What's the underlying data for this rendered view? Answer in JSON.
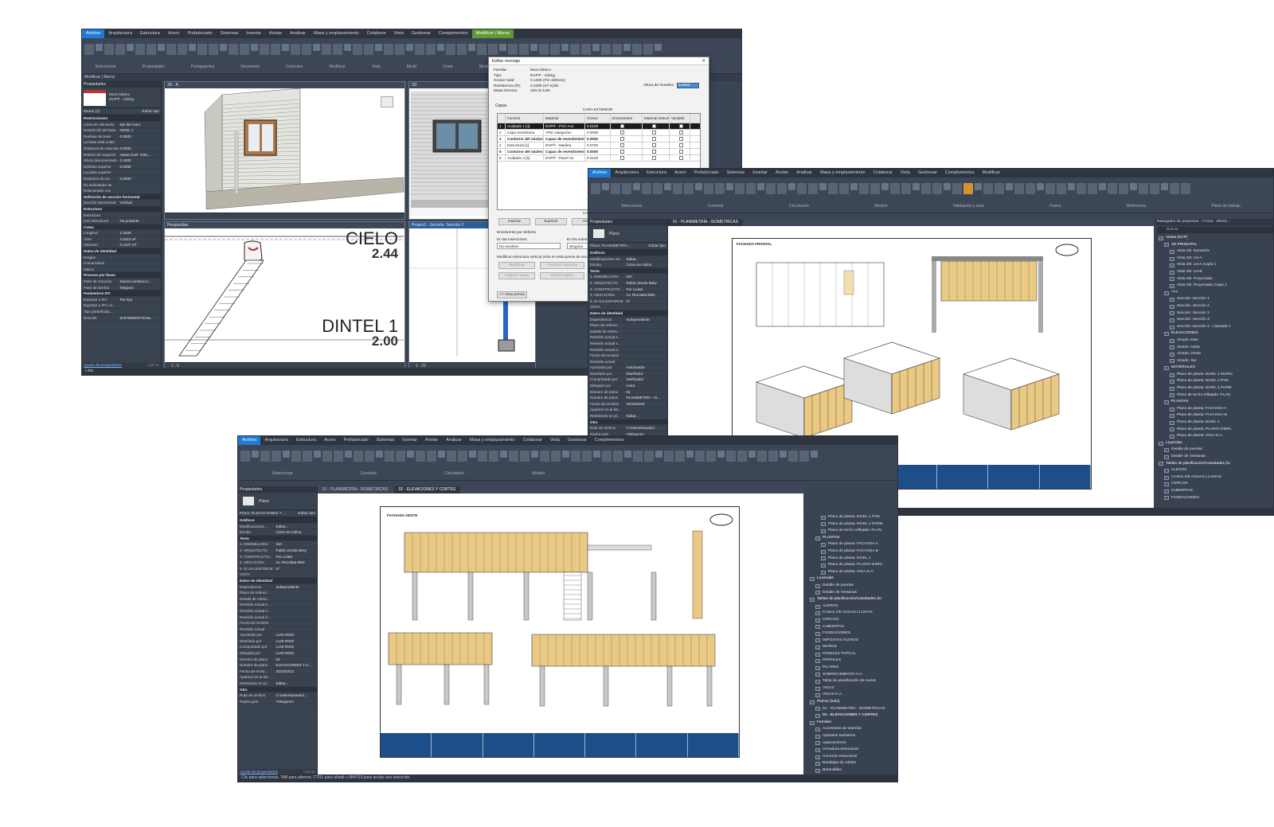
{
  "window1": {
    "menu": [
      "Archivo",
      "Arquitectura",
      "Estructura",
      "Acero",
      "Prefabricado",
      "Sistemas",
      "Insertar",
      "Anotar",
      "Analizar",
      "Masa y emplazamiento",
      "Colaborar",
      "Vista",
      "Gestionar",
      "Complementos",
      "Modificar | Muros"
    ],
    "ribbon_groups": [
      "Seleccionar",
      "Propiedades",
      "Portapapeles",
      "Geometría",
      "Controles",
      "Modificar",
      "Vista",
      "Medir",
      "Crear",
      "Modo"
    ],
    "subbar": "Modificar | Muros",
    "props_title": "Propiedades",
    "type_name": "Muro básico",
    "type_sub": "DVP® - Siding",
    "type_selector": "Muros (1)",
    "edit_type": "Editar tipo",
    "rows": [
      {
        "sec": "Restricciones"
      },
      {
        "k": "Línea de ubicación",
        "v": "Eje del muro"
      },
      {
        "k": "Restricción de base",
        "v": "NIVEL 1"
      },
      {
        "k": "Desfase de base",
        "v": "0.0000"
      },
      {
        "k": "La base está unida",
        "v": ""
      },
      {
        "k": "Distancia de extensión",
        "v": "0.0000"
      },
      {
        "k": "Restricción superior",
        "v": "Hasta nivel: CIEL..."
      },
      {
        "k": "Altura desconectada",
        "v": "2.4400"
      },
      {
        "k": "Desfase superior",
        "v": "0.0000"
      },
      {
        "k": "La parte superior",
        "v": ""
      },
      {
        "k": "Distancia de ext.",
        "v": "0.0000"
      },
      {
        "k": "Es delimitador de",
        "v": ""
      },
      {
        "k": "Relacionado con",
        "v": ""
      },
      {
        "sec": "Definición de sección horizontal"
      },
      {
        "k": "Sección transversal",
        "v": "Vertical"
      },
      {
        "sec": "Estructura"
      },
      {
        "k": "Estructura",
        "v": ""
      },
      {
        "k": "Uso estructural",
        "v": "No portante"
      },
      {
        "sec": "Cotas"
      },
      {
        "k": "Longitud",
        "v": "2.4000"
      },
      {
        "k": "Área",
        "v": "4.9112 m²"
      },
      {
        "k": "Volumen",
        "v": "0.1227 m³"
      },
      {
        "sec": "Datos de identidad"
      },
      {
        "k": "Imagen",
        "v": ""
      },
      {
        "k": "Comentarios",
        "v": ""
      },
      {
        "k": "Marca",
        "v": ""
      },
      {
        "sec": "Proceso por fases"
      },
      {
        "k": "Fase de creación",
        "v": "Nueva construcci..."
      },
      {
        "k": "Fase de derribo",
        "v": "Ninguno"
      },
      {
        "sec": "Parámetros IFC"
      },
      {
        "k": "Exportar a IFC",
        "v": "Por tipo"
      },
      {
        "k": "Exportar a IFC co...",
        "v": ""
      },
      {
        "k": "Tipo predefinido...",
        "v": ""
      },
      {
        "k": "IfcGUID",
        "v": "0mFWDBKh7IC6w..."
      }
    ],
    "props_help": "Ayuda de propiedades",
    "props_apply": "Aplicar",
    "vp1_tab": "3D - A",
    "vp2_tab": "3D",
    "vp3_tab": "Perspectiva",
    "vp4_tab": "Project1 - Sección: Sección 2",
    "label_cielo": "CIELO",
    "value_cielo": "2.44",
    "label_dintel": "DINTEL 1",
    "value_dintel": "2.00",
    "scale_a": "1 : 5",
    "scale_b": "1 : 20",
    "status": "Listo"
  },
  "dialog": {
    "title": "Editar montaje",
    "fields": [
      {
        "k": "Familia:",
        "v": "Muro básico"
      },
      {
        "k": "Tipo:",
        "v": "DVP® - Siding"
      },
      {
        "k": "Grosor total:",
        "v": "0.1400 (Por defecto)"
      },
      {
        "k": "Resistencia (R):",
        "v": "0.2289 (m²·K)/W"
      },
      {
        "k": "Masa térmica:",
        "v": "220.02 kJ/K"
      }
    ],
    "sample_height_label": "Altura de muestra:",
    "sample_height_value": "6.0000",
    "layers_label": "Capas",
    "exterior_side": "CARA EXTERIOR",
    "interior_side": "CARA INTERIOR",
    "columns": [
      "",
      "Función",
      "Material",
      "Grosor",
      "Envolventes",
      "Material estructural",
      "Variable"
    ],
    "rows": [
      {
        "n": "1",
        "f": "Acabado 1 [4]",
        "m": "DVP® - PVC Ace.",
        "g": "0.0100",
        "sel": true
      },
      {
        "n": "2",
        "f": "Capa membrana",
        "m": "<Por categoría>",
        "g": "0.0000",
        "sel": false
      },
      {
        "n": "3",
        "f": "Contorno del núcleo",
        "m": "Capas de revestimiento",
        "g": "0.0000",
        "sel": false
      },
      {
        "n": "4",
        "f": "Estructura [1]",
        "m": "DVP® - Madera",
        "g": "0.0700",
        "sel": false
      },
      {
        "n": "5",
        "f": "Contorno del núcleo",
        "m": "Capas de revestimiento",
        "g": "0.0000",
        "sel": false
      },
      {
        "n": "6",
        "f": "Acabado 2 [5]",
        "m": "DVP® - Panel Ye.",
        "g": "0.0100",
        "sel": false
      }
    ],
    "btn_insert": "Insertar",
    "btn_delete": "Suprimir",
    "btn_up": "Arriba",
    "wrap_label": "Envolvente por defecto",
    "at_inserts": "En las inserciones:",
    "at_inserts_value": "No envolver",
    "at_ends": "En los extremos:",
    "at_ends_value": "Ninguno",
    "modify_label": "Modificar estructura vertical (sólo en vista previa de sección)",
    "btn_modify": "Modificar",
    "btn_merge": "Fusionar regiones",
    "btn_assign": "Asignar capas",
    "btn_split": "Dividir región",
    "btn_preview": "<< Vista previa"
  },
  "window2": {
    "menu": [
      "Archivo",
      "Arquitectura",
      "Estructura",
      "Acero",
      "Prefabricado",
      "Sistemas",
      "Insertar",
      "Anotar",
      "Analizar",
      "Masa y emplazamiento",
      "Colaborar",
      "Vista",
      "Gestionar",
      "Complementos",
      "Modificar"
    ],
    "ribbon_groups": [
      "Seleccionar",
      "Construir",
      "Circulación",
      "Modelo",
      "Habitación y área",
      "Hueco",
      "Referencia",
      "Plano de trabajo"
    ],
    "ribbon_active": "Modificar",
    "props_title": "Propiedades",
    "type_name": "Plano",
    "type_selector": "Plano: PLANIMETRÍA ...",
    "edit_type": "Editar tipo",
    "sheet_tab": "01 - PLANIMETRÍA - ISOMÉTRICAS",
    "sheet_title": "FACHADA FRONTAL",
    "rows": [
      {
        "sec": "Gráficos"
      },
      {
        "k": "Modificaciones vis...",
        "v": "Editar..."
      },
      {
        "k": "Escala",
        "v": "Como se indica"
      },
      {
        "sec": "Texto"
      },
      {
        "k": "1. INMOBILIARIA",
        "v": "N/A"
      },
      {
        "k": "2. ARQUITECTO",
        "v": "Pablo Urrutia Mery"
      },
      {
        "k": "3. CONSTRUCTO...",
        "v": "Por Licitar"
      },
      {
        "k": "4. UBICACIÓN",
        "v": "Av. Recoleta 9NN"
      },
      {
        "k": "5. ID SALESFORCE",
        "v": "N°"
      },
      {
        "k": "VISTA",
        "v": ""
      },
      {
        "sec": "Datos de identidad"
      },
      {
        "k": "Dependencia",
        "v": "Independiente"
      },
      {
        "k": "Plano de referen...",
        "v": ""
      },
      {
        "k": "Detalle de refere...",
        "v": ""
      },
      {
        "k": "Revisión actual e...",
        "v": ""
      },
      {
        "k": "Revisión actual e...",
        "v": ""
      },
      {
        "k": "Revisión actual d...",
        "v": ""
      },
      {
        "k": "Fecha de revisión",
        "v": ""
      },
      {
        "k": "Revisión actual",
        "v": ""
      },
      {
        "k": "Aprobado por",
        "v": "Autorizador"
      },
      {
        "k": "Diseñado por",
        "v": "Diseñador"
      },
      {
        "k": "Comprobado por",
        "v": "Verificador"
      },
      {
        "k": "Dibujado por",
        "v": "Autor"
      },
      {
        "k": "Número de plano",
        "v": "01"
      },
      {
        "k": "Nombre de plano",
        "v": "PLANIMETRÍA - IS..."
      },
      {
        "k": "Fecha de emisión",
        "v": "20/10/2023"
      },
      {
        "k": "Aparece en la list...",
        "v": ""
      },
      {
        "k": "Revisiones en pl...",
        "v": "Editar..."
      },
      {
        "sec": "Otro"
      },
      {
        "k": "Ruta de archivo",
        "v": "C:\\Users\\usuario\\..."
      },
      {
        "k": "Rayita guía",
        "v": "<Ninguno>"
      }
    ],
    "props_help": "Ayuda de propiedades",
    "props_apply": "Aplicar",
    "browser_title": "Navegador de proyectos - C7101 - DESC...",
    "browser_search": "Buscar",
    "tree": [
      {
        "t": "Vistas (DVP)",
        "hd": true,
        "lv": 0
      },
      {
        "t": "3D PRINCIPAL",
        "hd": true,
        "lv": 1
      },
      {
        "t": "Vista 3D: Isometría",
        "lv": 2
      },
      {
        "t": "Vista 3D: LN-A",
        "lv": 2
      },
      {
        "t": "Vista 3D: LN-A Copia 1",
        "lv": 2
      },
      {
        "t": "Vista 3D: LN-B",
        "lv": 2
      },
      {
        "t": "Vista 3D: Proyectado",
        "lv": 2
      },
      {
        "t": "Vista 3D: Proyectado Copia 1",
        "lv": 2
      },
      {
        "t": "???",
        "hd": true,
        "lv": 1
      },
      {
        "t": "Sección: Sección 1",
        "lv": 2
      },
      {
        "t": "Sección: Sección 2",
        "lv": 2
      },
      {
        "t": "Sección: Sección 3",
        "lv": 2
      },
      {
        "t": "Sección: Sección 4",
        "lv": 2
      },
      {
        "t": "Sección: Sección 4 - Llamada 1",
        "lv": 2
      },
      {
        "t": "ELEVACIONES",
        "hd": true,
        "lv": 1
      },
      {
        "t": "Alzado: Este",
        "lv": 2
      },
      {
        "t": "Alzado: Norte",
        "lv": 2
      },
      {
        "t": "Alzado: Oeste",
        "lv": 2
      },
      {
        "t": "Alzado: Sur",
        "lv": 2
      },
      {
        "t": "MATERIALES",
        "hd": true,
        "lv": 1
      },
      {
        "t": "Plano de planta: NIVEL 1 MURO",
        "lv": 2
      },
      {
        "t": "Plano de planta: NIVEL 1 PVN",
        "lv": 2
      },
      {
        "t": "Plano de planta: NIVEL 1 PARM",
        "lv": 2
      },
      {
        "t": "Plano de techo reflejado: PLAN",
        "lv": 2
      },
      {
        "t": "PLANTAS",
        "hd": true,
        "lv": 1
      },
      {
        "t": "Plano de planta: FACHADA A",
        "lv": 2
      },
      {
        "t": "Plano de planta: FACHADA B",
        "lv": 2
      },
      {
        "t": "Plano de planta: NIVEL 1",
        "lv": 2
      },
      {
        "t": "Plano de planta: PLANTA EMPL.",
        "lv": 2
      },
      {
        "t": "Plano de planta: VIGA N.A.",
        "lv": 2
      },
      {
        "t": "Leyendas",
        "hd": true,
        "lv": 0
      },
      {
        "t": "Detalle de puertas",
        "lv": 1
      },
      {
        "t": "Detalle de Ventanas",
        "lv": 1
      },
      {
        "t": "Tablas de planificación/Cantidades (to",
        "hd": true,
        "lv": 0
      },
      {
        "t": "ALEROS",
        "lv": 1
      },
      {
        "t": "CANAL DE AGUAS LLUVIAS",
        "lv": 1
      },
      {
        "t": "CERCOS",
        "lv": 1
      },
      {
        "t": "CUBIERTAS",
        "lv": 1
      },
      {
        "t": "FUNDACIONES",
        "lv": 1
      }
    ],
    "status": "Clic para seleccionar, TAB para alternar, CTRL para añadir y MAYÚS para anular una selección."
  },
  "window3": {
    "menu": [
      "Archivo",
      "Arquitectura",
      "Estructura",
      "Acero",
      "Prefabricado",
      "Sistemas",
      "Insertar",
      "Anotar",
      "Analizar",
      "Masa y emplazamiento",
      "Colaborar",
      "Vista",
      "Gestionar",
      "Complementos"
    ],
    "ribbon_groups": [
      "Seleccionar",
      "Construir",
      "Circulación",
      "Modelo"
    ],
    "props_title": "Propiedades",
    "type_name": "Plano",
    "type_selector": "Plano: ELEVACIONES Y ...",
    "edit_type": "Editar tipo",
    "tab1": "01 - PLANIMETRÍA - ISOMÉTRICAS",
    "tab2": "02 - ELEVACIONES Y CORTES",
    "sheet_title": "FACHADA OESTE",
    "rows": [
      {
        "sec": "Gráficos"
      },
      {
        "k": "Modificaciones ...",
        "v": "Editar..."
      },
      {
        "k": "Escala",
        "v": "Como se indica"
      },
      {
        "sec": "Texto"
      },
      {
        "k": "1. INMOBILIARIA",
        "v": "N/A"
      },
      {
        "k": "2. ARQUITECTO",
        "v": "Pablo Urrutia Mery"
      },
      {
        "k": "3. CONSTRUCTO...",
        "v": "Por Licitar"
      },
      {
        "k": "4. UBICACIÓN",
        "v": "Av. Recoleta 9NN"
      },
      {
        "k": "5. ID SALESFORCE",
        "v": "N°"
      },
      {
        "k": "VISTA",
        "v": ""
      },
      {
        "sec": "Datos de identidad"
      },
      {
        "k": "Dependencia",
        "v": "Independiente"
      },
      {
        "k": "Plano de referen...",
        "v": ""
      },
      {
        "k": "Detalle de refere...",
        "v": ""
      },
      {
        "k": "Revisión actual e...",
        "v": ""
      },
      {
        "k": "Revisión actual e...",
        "v": ""
      },
      {
        "k": "Revisión actual d...",
        "v": ""
      },
      {
        "k": "Fecha de revisión",
        "v": ""
      },
      {
        "k": "Revisión actual",
        "v": ""
      },
      {
        "k": "Aprobado por",
        "v": "LUIS RIOS"
      },
      {
        "k": "Diseñado por",
        "v": "LUIS RIOS"
      },
      {
        "k": "Comprobado por",
        "v": "LUIS RIOS"
      },
      {
        "k": "Dibujado por",
        "v": "LUIS RIOS"
      },
      {
        "k": "Número de plano",
        "v": "02"
      },
      {
        "k": "Nombre de plano",
        "v": "ELEVACIONES Y C..."
      },
      {
        "k": "Fecha de emisi...",
        "v": "20/10/2021"
      },
      {
        "k": "Aparece en la list...",
        "v": ""
      },
      {
        "k": "Revisiones en pl...",
        "v": "Editar..."
      },
      {
        "sec": "Otro"
      },
      {
        "k": "Ruta de archivo",
        "v": "C:\\Users\\usuario\\..."
      },
      {
        "k": "Rayita guía",
        "v": "<Ninguno>"
      }
    ],
    "props_help": "Ayuda de propiedades",
    "props_apply": "Aplicar",
    "tree": [
      {
        "t": "Plano de planta: NIVEL 1 PVN",
        "lv": 2
      },
      {
        "t": "Plano de planta: NIVEL 1 PARM",
        "lv": 2
      },
      {
        "t": "Plano de techo reflejado: PLAN",
        "lv": 2
      },
      {
        "t": "PLANTAS",
        "hd": true,
        "lv": 1
      },
      {
        "t": "Plano de planta: FACHADA A",
        "lv": 2
      },
      {
        "t": "Plano de planta: FACHADA B",
        "lv": 2
      },
      {
        "t": "Plano de planta: NIVEL 1",
        "lv": 2
      },
      {
        "t": "Plano de planta: PLANTA EMPL.",
        "lv": 2
      },
      {
        "t": "Plano de planta: VIGA N.A.",
        "lv": 2
      },
      {
        "t": "Leyendas",
        "hd": true,
        "lv": 0
      },
      {
        "t": "Detalle de puertas",
        "lv": 1
      },
      {
        "t": "Detalle de Ventanas",
        "lv": 1
      },
      {
        "t": "Tablas de planificación/Cantidades (to",
        "hd": true,
        "lv": 0
      },
      {
        "t": "ALEROS",
        "lv": 1
      },
      {
        "t": "CANAL DE AGUAS LLUVIAS",
        "lv": 1
      },
      {
        "t": "CERCOS",
        "lv": 1
      },
      {
        "t": "CUBIERTAS",
        "lv": 1
      },
      {
        "t": "FUNDACIONES",
        "lv": 1
      },
      {
        "t": "IMPOSTAS ALEROS",
        "lv": 1
      },
      {
        "t": "MUROS",
        "lv": 1
      },
      {
        "t": "PANELES TOPCAL",
        "lv": 1
      },
      {
        "t": "PERFILES",
        "lv": 1
      },
      {
        "t": "PILARES",
        "lv": 1
      },
      {
        "t": "SOBRECIMIENTO H.A.",
        "lv": 1
      },
      {
        "t": "Tabla de planificación de muros",
        "lv": 1
      },
      {
        "t": "VIGAS",
        "lv": 1
      },
      {
        "t": "VIGAS H.A.",
        "lv": 1
      },
      {
        "t": "Planos (todo)",
        "hd": true,
        "lv": 0
      },
      {
        "t": "01 - PLANIMETRÍA - ISOMÉTRICAS",
        "lv": 1
      },
      {
        "t": "02 - ELEVACIONES Y CORTES",
        "lv": 1,
        "bold": true
      },
      {
        "t": "Familias",
        "hd": true,
        "lv": 0
      },
      {
        "t": "Accesorios de tuberías",
        "lv": 1
      },
      {
        "t": "Aparatos sanitarios",
        "lv": 1
      },
      {
        "t": "Aparcamiento",
        "lv": 1
      },
      {
        "t": "Armadura estructural",
        "lv": 1
      },
      {
        "t": "Armazón estructural",
        "lv": 1
      },
      {
        "t": "Bandejas de cables",
        "lv": 1
      },
      {
        "t": "Barandillas",
        "lv": 1
      }
    ],
    "status": "Clic para seleccionar, TAB para alternar, CTRL para añadir y MAYÚS para anular una selección."
  },
  "colors": {
    "accent": "#1e7ad6",
    "ribbon_bg": "#3c4656",
    "panel_bg": "#3a4350",
    "titleblock": "#1e4e8a",
    "wood": "#e9c983"
  }
}
